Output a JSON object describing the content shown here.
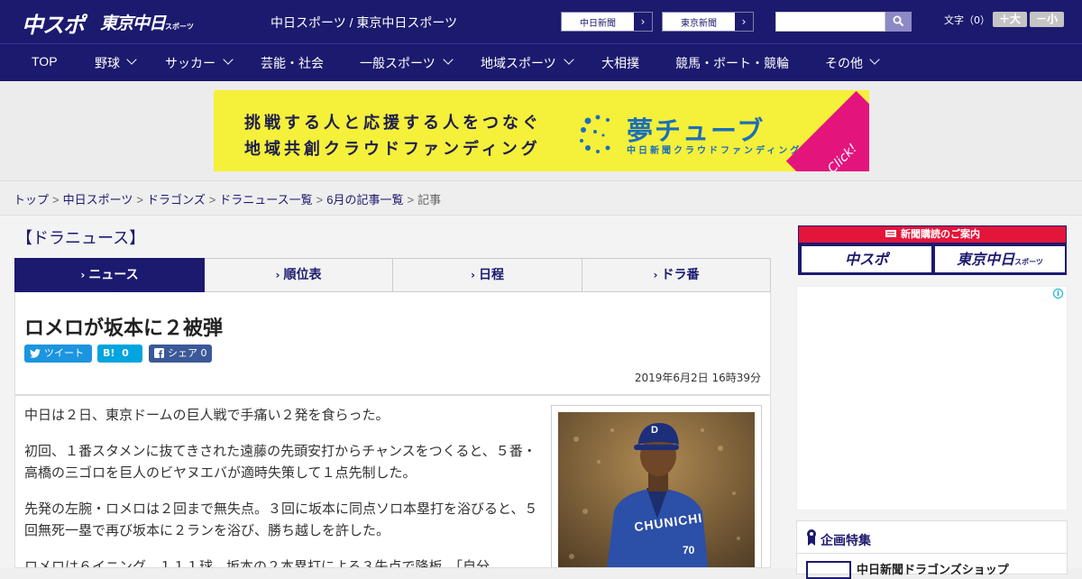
{
  "header": {
    "logo_main": "中スポ",
    "logo_tokyo": "東京中日",
    "logo_tokyo_small": "スポーツ",
    "site_title": "中日スポーツ / 東京中日スポーツ",
    "link_chunichi": "中日新聞",
    "link_tokyo": "東京新聞",
    "link_arrow": "›",
    "search_placeholder": "",
    "font_label": "文字（0）",
    "font_bigger": "＋大",
    "font_smaller": "－小"
  },
  "nav": {
    "items": [
      {
        "label": "TOP"
      },
      {
        "label": "野球"
      },
      {
        "label": "サッカー"
      },
      {
        "label": "芸能・社会"
      },
      {
        "label": "一般スポーツ"
      },
      {
        "label": "地域スポーツ"
      },
      {
        "label": "大相撲"
      },
      {
        "label": "競馬・ボート・競輪"
      },
      {
        "label": "その他"
      }
    ]
  },
  "banner": {
    "line1": "挑戦する人と応援する人をつなぐ",
    "line2": "地域共創クラウドファンディング",
    "brand": "夢チューブ",
    "sub": "中日新聞クラウドファンディング",
    "click": "Click!"
  },
  "breadcrumb": {
    "items": [
      "トップ",
      "中日スポーツ",
      "ドラゴンズ",
      "ドラニュース一覧",
      "6月の記事一覧"
    ],
    "current": "記事",
    "separator": ">"
  },
  "section": {
    "title": "【ドラニュース】"
  },
  "tabs": [
    {
      "label": "ニュース",
      "active": true
    },
    {
      "label": "順位表",
      "active": false
    },
    {
      "label": "日程",
      "active": false
    },
    {
      "label": "ドラ番",
      "active": false
    }
  ],
  "article": {
    "title": "ロメロが坂本に２被弾",
    "share_tweet": "ツイート",
    "share_hatena": "0",
    "share_fb": "シェア 0",
    "date": "2019年6月2日 16時39分",
    "paragraphs": [
      "中日は２日、東京ドームの巨人戦で手痛い２発を食らった。",
      "初回、１番スタメンに抜てきされた遠藤の先頭安打からチャンスをつくると、５番・高橋の三ゴロを巨人のビヤヌエバが適時失策して１点先制した。",
      "先発の左腕・ロメロは２回まで無失点。３回に坂本に同点ソロ本塁打を浴びると、５回無死一塁で再び坂本に２ランを浴び、勝ち越しを許した。",
      "ロメロは６イニング、１１１球、坂本の２本塁打による３失点で降板。「自分"
    ],
    "photo_jersey": "CHUNICHI",
    "photo_cap": "D",
    "photo_number": "70"
  },
  "sidebar": {
    "subscribe_title": "新聞購読のご案内",
    "subscribe_chuspo": "中スポ",
    "subscribe_tokyo": "東京中日",
    "subscribe_tokyo_small": "スポーツ",
    "ad_info": "i",
    "special_title": "企画特集",
    "special_item": "中日新聞ドラゴンズショップ"
  },
  "colors": {
    "navy": "#1c1a6e",
    "banner_yellow": "#f5f03a",
    "sub_red": "#e3153a",
    "twitter": "#1b95e0",
    "hatena": "#00a4de",
    "facebook": "#3b5998"
  }
}
